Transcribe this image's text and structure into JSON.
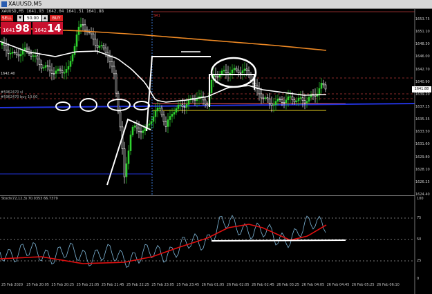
{
  "window": {
    "title": "XAUUSD,M5"
  },
  "ohlc_line": "XAUUSD,M5  1641.93 1642.04 1641.51 1641.88",
  "trade_panel": {
    "sell_label": "SELL",
    "buy_label": "BUY",
    "lots": "50.00",
    "sell_small": "1641",
    "sell_big": "98",
    "buy_small": "1642",
    "buy_big": "14"
  },
  "labels": {
    "sr_tag": "SR1",
    "left_price": "1642.40",
    "l1": "#5962470 sl",
    "l2": "#5962470 buy 10.00"
  },
  "price_axis": [
    "1653.75",
    "1651.10",
    "1648.30",
    "1646.00",
    "1642.70",
    "1640.90",
    "1639.20",
    "1637.25",
    "1635.35",
    "1633.50",
    "1631.60",
    "1629.80",
    "1628.10",
    "1626.25",
    "1624.40"
  ],
  "current_price": "1641.88",
  "stoch": {
    "label": "Stoch(72,12,3) 70.0353 66.7379",
    "axis": [
      "100",
      "75",
      "50",
      "25",
      "0"
    ]
  },
  "time_axis": [
    "25 Feb 2020",
    "25 Feb 20:05",
    "25 Feb 20:25",
    "25 Feb 21:05",
    "25 Feb 21:45",
    "25 Feb 22:25",
    "25 Feb 23:05",
    "25 Feb 23:45",
    "26 Feb 01:05",
    "26 Feb 02:05",
    "26 Feb 02:45",
    "26 Feb 03:25",
    "26 Feb 04:05",
    "26 Feb 04:45",
    "26 Feb 05:25",
    "26 Feb 06:10"
  ],
  "colors": {
    "background": "#000000",
    "bull": "#2fd12f",
    "bear": "#ffffff",
    "ma_fast": "#ffffff",
    "ma_slow": "#f08a24",
    "blue_line": "#2233dd",
    "yellow_line": "#e8d020",
    "stoch_main": "#7fb7d9",
    "stoch_signal": "#e01010"
  }
}
